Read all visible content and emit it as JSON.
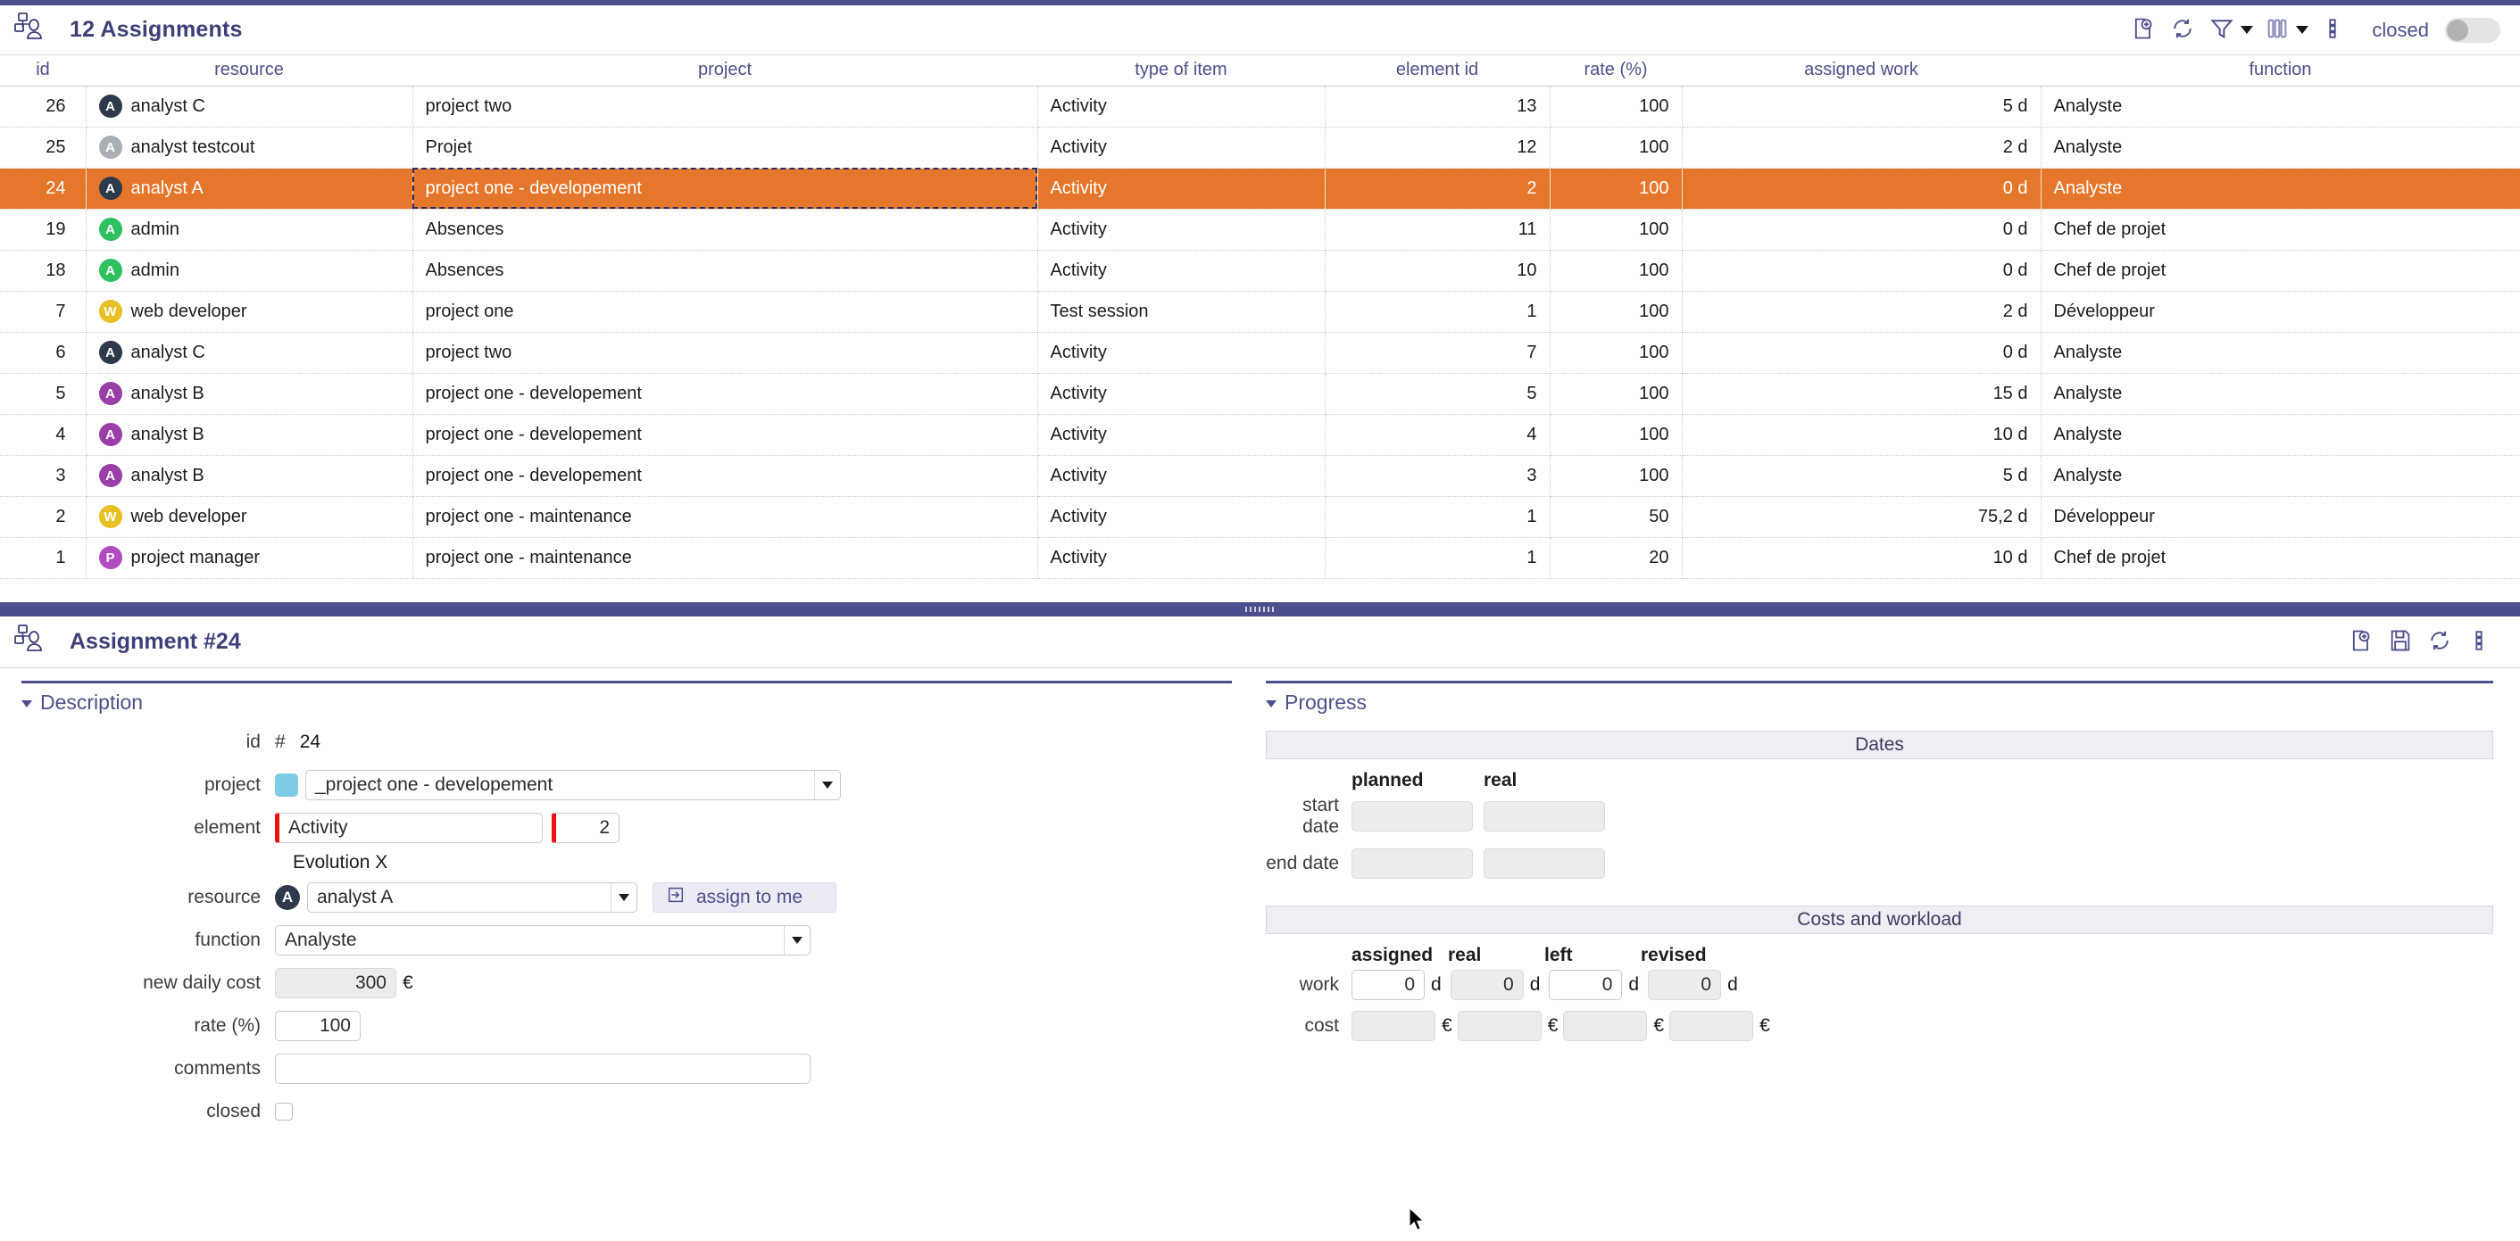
{
  "list": {
    "title": "12 Assignments",
    "icon": "org-chart-person-icon",
    "toolbar": {
      "add_label": "add-document-icon",
      "refresh_label": "refresh-icon",
      "filter_label": "filter-icon",
      "columns_label": "columns-icon",
      "more_label": "more-options-icon",
      "closed_label": "closed"
    },
    "columns": [
      "id",
      "resource",
      "project",
      "type of item",
      "element id",
      "rate (%)",
      "assigned work",
      "function"
    ],
    "rows": [
      {
        "id": "26",
        "resource": "analyst C",
        "initial": "A",
        "color": "#2c3a4b",
        "project": "project two",
        "type": "Activity",
        "element_id": "13",
        "rate": "100",
        "work": "5 d",
        "function": "Analyste",
        "selected": false
      },
      {
        "id": "25",
        "resource": "analyst testcout",
        "initial": "A",
        "color": "#a9b0b5",
        "project": "Projet",
        "type": "Activity",
        "element_id": "12",
        "rate": "100",
        "work": "2 d",
        "function": "Analyste",
        "selected": false
      },
      {
        "id": "24",
        "resource": "analyst A",
        "initial": "A",
        "color": "#2c3a4b",
        "project": "project one - developement",
        "type": "Activity",
        "element_id": "2",
        "rate": "100",
        "work": "0 d",
        "function": "Analyste",
        "selected": true
      },
      {
        "id": "19",
        "resource": "admin",
        "initial": "A",
        "color": "#2fc15f",
        "project": "Absences",
        "type": "Activity",
        "element_id": "11",
        "rate": "100",
        "work": "0 d",
        "function": "Chef de projet",
        "selected": false
      },
      {
        "id": "18",
        "resource": "admin",
        "initial": "A",
        "color": "#2fc15f",
        "project": "Absences",
        "type": "Activity",
        "element_id": "10",
        "rate": "100",
        "work": "0 d",
        "function": "Chef de projet",
        "selected": false
      },
      {
        "id": "7",
        "resource": "web developer",
        "initial": "W",
        "color": "#e8c024",
        "project": "project one",
        "type": "Test session",
        "element_id": "1",
        "rate": "100",
        "work": "2 d",
        "function": "Développeur",
        "selected": false
      },
      {
        "id": "6",
        "resource": "analyst C",
        "initial": "A",
        "color": "#2c3a4b",
        "project": "project two",
        "type": "Activity",
        "element_id": "7",
        "rate": "100",
        "work": "0 d",
        "function": "Analyste",
        "selected": false
      },
      {
        "id": "5",
        "resource": "analyst B",
        "initial": "A",
        "color": "#9b3fa8",
        "project": "project one - developement",
        "type": "Activity",
        "element_id": "5",
        "rate": "100",
        "work": "15 d",
        "function": "Analyste",
        "selected": false
      },
      {
        "id": "4",
        "resource": "analyst B",
        "initial": "A",
        "color": "#9b3fa8",
        "project": "project one - developement",
        "type": "Activity",
        "element_id": "4",
        "rate": "100",
        "work": "10 d",
        "function": "Analyste",
        "selected": false
      },
      {
        "id": "3",
        "resource": "analyst B",
        "initial": "A",
        "color": "#9b3fa8",
        "project": "project one - developement",
        "type": "Activity",
        "element_id": "3",
        "rate": "100",
        "work": "5 d",
        "function": "Analyste",
        "selected": false
      },
      {
        "id": "2",
        "resource": "web developer",
        "initial": "W",
        "color": "#e8c024",
        "project": "project one - maintenance",
        "type": "Activity",
        "element_id": "1",
        "rate": "50",
        "work": "75,2 d",
        "function": "Développeur",
        "selected": false
      },
      {
        "id": "1",
        "resource": "project manager",
        "initial": "P",
        "color": "#b04bc0",
        "project": "project one - maintenance",
        "type": "Activity",
        "element_id": "1",
        "rate": "20",
        "work": "10 d",
        "function": "Chef de projet",
        "selected": false
      }
    ]
  },
  "detail": {
    "title": "Assignment  #24",
    "icon": "org-chart-person-icon",
    "toolbar": {
      "add_label": "add-document-icon",
      "save_label": "save-icon",
      "refresh_label": "refresh-icon",
      "more_label": "more-options-icon"
    },
    "description": {
      "section_title": "Description",
      "id_label": "id",
      "id_hash": "#",
      "id_value": "24",
      "project_label": "project",
      "project_value": "_project one - developement",
      "project_color": "#7fcce5",
      "element_label": "element",
      "element_value": "Activity",
      "element_id_value": "2",
      "element_sub": "Evolution X",
      "resource_label": "resource",
      "resource_value": "analyst A",
      "resource_initial": "A",
      "resource_color": "#2c3a4b",
      "assign_button": "assign to me",
      "assign_icon": "arrow-into-box-icon",
      "function_label": "function",
      "function_value": "Analyste",
      "daily_cost_label": "new daily cost",
      "daily_cost_value": "300",
      "daily_cost_unit": "€",
      "rate_label": "rate (%)",
      "rate_value": "100",
      "comments_label": "comments",
      "comments_value": "",
      "closed_label": "closed",
      "closed_checked": false
    },
    "progress": {
      "section_title": "Progress",
      "dates_band": "Dates",
      "dates_headers": [
        "planned",
        "real"
      ],
      "start_label": "start date",
      "start_planned": "",
      "start_real": "",
      "end_label": "end date",
      "end_planned": "",
      "end_real": "",
      "costs_band": "Costs and workload",
      "costs_headers": [
        "assigned",
        "real",
        "left",
        "revised"
      ],
      "work_label": "work",
      "work_assigned": "0",
      "work_real": "0",
      "work_left": "0",
      "work_revised": "0",
      "work_unit": "d",
      "cost_label": "cost",
      "cost_assigned": "",
      "cost_real": "",
      "cost_left": "",
      "cost_revised": "",
      "cost_unit": "€"
    }
  }
}
